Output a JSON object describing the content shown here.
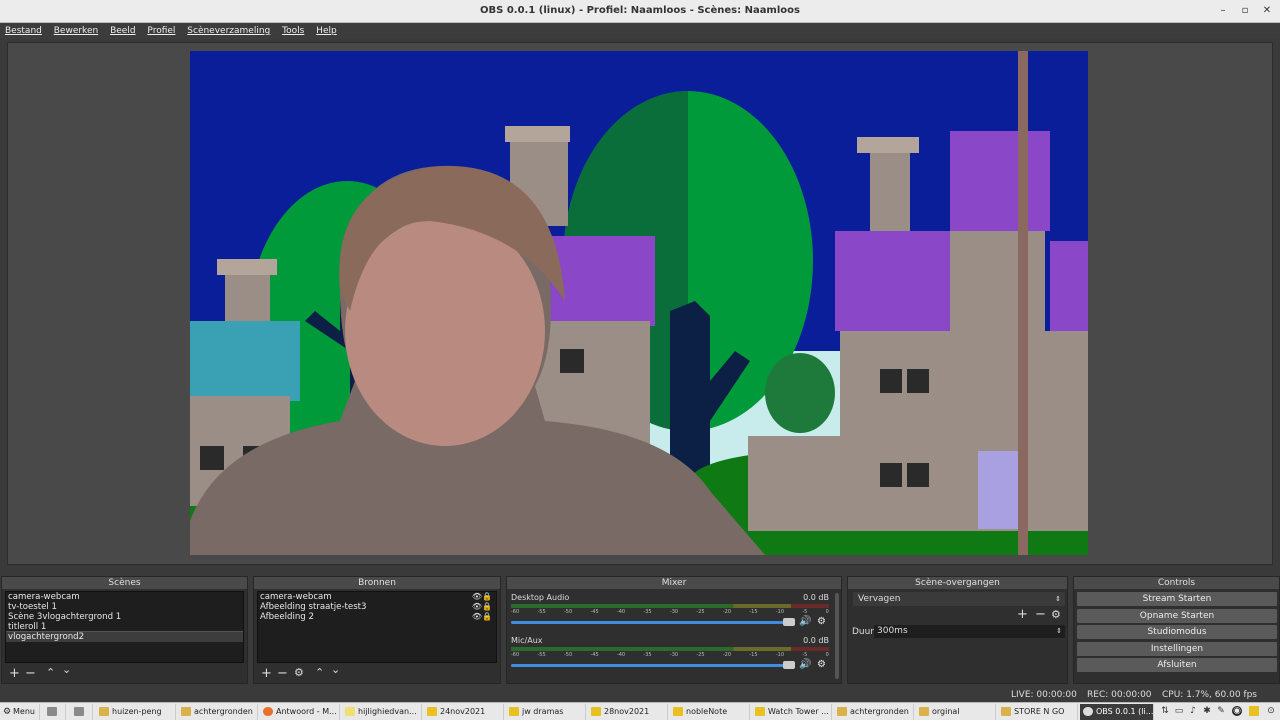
{
  "window": {
    "title": "OBS 0.0.1 (linux) - Profiel: Naamloos - Scènes: Naamloos"
  },
  "menu": [
    "Bestand",
    "Bewerken",
    "Beeld",
    "Profiel",
    "Scèneverzameling",
    "Tools",
    "Help"
  ],
  "scenes": {
    "header": "Scènes",
    "items": [
      "camera-webcam",
      "tv-toestel 1",
      "Scène 3vlogachtergrond 1",
      "titleroll 1",
      "vlogachtergrond2"
    ],
    "selected_index": 4
  },
  "sources": {
    "header": "Bronnen",
    "items": [
      "camera-webcam",
      "Afbeelding straatje-test3",
      "Afbeelding 2"
    ]
  },
  "mixer": {
    "header": "Mixer",
    "channels": [
      {
        "name": "Desktop Audio",
        "db": "0.0 dB",
        "volume": 1.0
      },
      {
        "name": "Mic/Aux",
        "db": "0.0 dB",
        "volume": 1.0
      }
    ],
    "scale": [
      "-60",
      "-55",
      "-50",
      "-45",
      "-40",
      "-35",
      "-30",
      "-25",
      "-20",
      "-15",
      "-10",
      "-5",
      "0"
    ]
  },
  "transitions": {
    "header": "Scène-overgangen",
    "selected": "Vervagen",
    "duration_label": "Duur",
    "duration_value": "300ms"
  },
  "controls": {
    "header": "Controls",
    "buttons": [
      "Stream Starten",
      "Opname Starten",
      "Studiomodus",
      "Instellingen",
      "Afsluiten"
    ]
  },
  "status": {
    "live": "LIVE: 00:00:00",
    "rec": "REC: 00:00:00",
    "cpu": "CPU: 1.7%, 60.00 fps"
  },
  "taskbar": {
    "menu_label": "Menu",
    "tasks": [
      {
        "label": "huizen-peng",
        "icon": "folder-icon"
      },
      {
        "label": "achtergronden",
        "icon": "folder-icon"
      },
      {
        "label": "Antwoord - M...",
        "icon": "firefox-icon"
      },
      {
        "label": "hijlighiedvan...",
        "icon": "document-icon"
      },
      {
        "label": "24nov2021",
        "icon": "folder-icon"
      },
      {
        "label": "jw dramas",
        "icon": "folder-icon"
      },
      {
        "label": "28nov2021",
        "icon": "folder-icon"
      },
      {
        "label": "nobleNote",
        "icon": "folder-icon"
      },
      {
        "label": "Watch Tower ...",
        "icon": "folder-icon"
      },
      {
        "label": "achtergronden",
        "icon": "folder-icon"
      },
      {
        "label": "orginal",
        "icon": "folder-icon"
      },
      {
        "label": "STORE N GO",
        "icon": "folder-icon"
      },
      {
        "label": "OBS 0.0.1 (li...",
        "icon": "obs-icon"
      }
    ]
  },
  "colors": {
    "accent": "#3e8de0",
    "panel": "#2f2f2f",
    "sky": "#0a1e9a",
    "grass": "#0f7a14"
  }
}
